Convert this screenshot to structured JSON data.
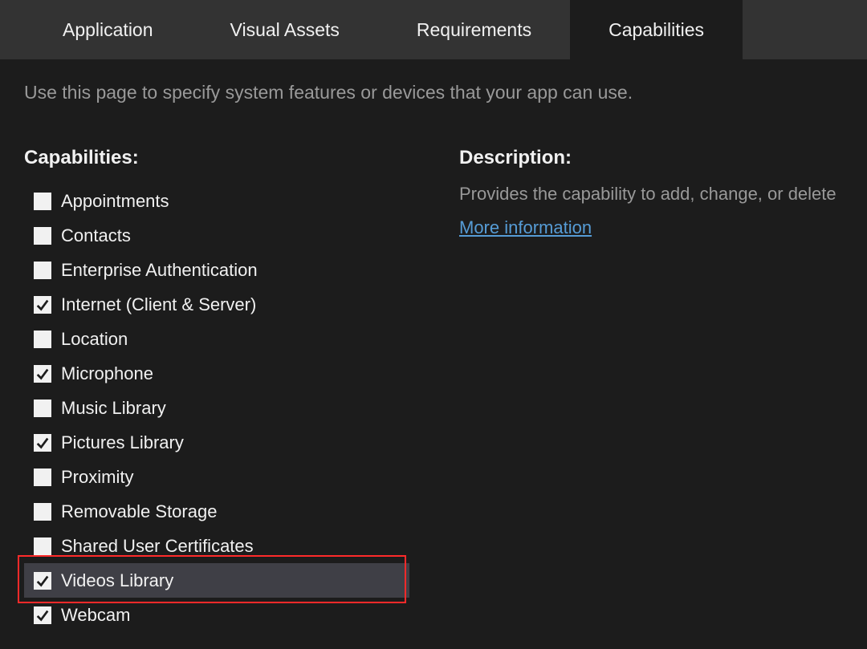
{
  "tabs": {
    "items": [
      {
        "label": "Application",
        "active": false
      },
      {
        "label": "Visual Assets",
        "active": false
      },
      {
        "label": "Requirements",
        "active": false
      },
      {
        "label": "Capabilities",
        "active": true
      }
    ]
  },
  "page_description": "Use this page to specify system features or devices that your app can use.",
  "capabilities_heading": "Capabilities:",
  "capabilities": [
    {
      "label": "Appointments",
      "checked": false,
      "selected": false
    },
    {
      "label": "Contacts",
      "checked": false,
      "selected": false
    },
    {
      "label": "Enterprise Authentication",
      "checked": false,
      "selected": false
    },
    {
      "label": "Internet (Client & Server)",
      "checked": true,
      "selected": false
    },
    {
      "label": "Location",
      "checked": false,
      "selected": false
    },
    {
      "label": "Microphone",
      "checked": true,
      "selected": false
    },
    {
      "label": "Music Library",
      "checked": false,
      "selected": false
    },
    {
      "label": "Pictures Library",
      "checked": true,
      "selected": false
    },
    {
      "label": "Proximity",
      "checked": false,
      "selected": false
    },
    {
      "label": "Removable Storage",
      "checked": false,
      "selected": false
    },
    {
      "label": "Shared User Certificates",
      "checked": false,
      "selected": false
    },
    {
      "label": "Videos Library",
      "checked": true,
      "selected": true
    },
    {
      "label": "Webcam",
      "checked": true,
      "selected": false
    }
  ],
  "highlight_index": 11,
  "description_heading": "Description:",
  "description_text": "Provides the capability to add, change, or delete",
  "more_link_label": "More information"
}
